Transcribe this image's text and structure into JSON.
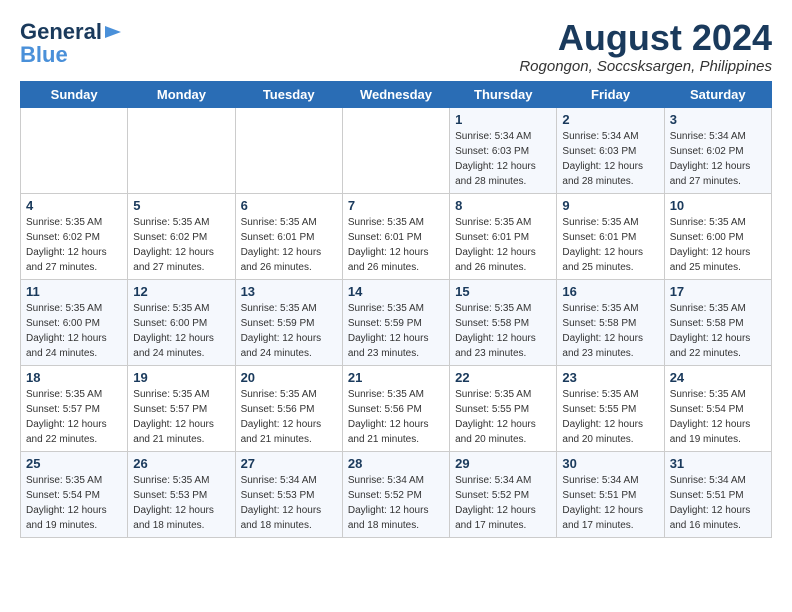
{
  "logo": {
    "line1": "General",
    "line2": "Blue"
  },
  "title": "August 2024",
  "location": "Rogongon, Soccsksargen, Philippines",
  "days_of_week": [
    "Sunday",
    "Monday",
    "Tuesday",
    "Wednesday",
    "Thursday",
    "Friday",
    "Saturday"
  ],
  "weeks": [
    [
      {
        "num": "",
        "info": ""
      },
      {
        "num": "",
        "info": ""
      },
      {
        "num": "",
        "info": ""
      },
      {
        "num": "",
        "info": ""
      },
      {
        "num": "1",
        "info": "Sunrise: 5:34 AM\nSunset: 6:03 PM\nDaylight: 12 hours\nand 28 minutes."
      },
      {
        "num": "2",
        "info": "Sunrise: 5:34 AM\nSunset: 6:03 PM\nDaylight: 12 hours\nand 28 minutes."
      },
      {
        "num": "3",
        "info": "Sunrise: 5:34 AM\nSunset: 6:02 PM\nDaylight: 12 hours\nand 27 minutes."
      }
    ],
    [
      {
        "num": "4",
        "info": "Sunrise: 5:35 AM\nSunset: 6:02 PM\nDaylight: 12 hours\nand 27 minutes."
      },
      {
        "num": "5",
        "info": "Sunrise: 5:35 AM\nSunset: 6:02 PM\nDaylight: 12 hours\nand 27 minutes."
      },
      {
        "num": "6",
        "info": "Sunrise: 5:35 AM\nSunset: 6:01 PM\nDaylight: 12 hours\nand 26 minutes."
      },
      {
        "num": "7",
        "info": "Sunrise: 5:35 AM\nSunset: 6:01 PM\nDaylight: 12 hours\nand 26 minutes."
      },
      {
        "num": "8",
        "info": "Sunrise: 5:35 AM\nSunset: 6:01 PM\nDaylight: 12 hours\nand 26 minutes."
      },
      {
        "num": "9",
        "info": "Sunrise: 5:35 AM\nSunset: 6:01 PM\nDaylight: 12 hours\nand 25 minutes."
      },
      {
        "num": "10",
        "info": "Sunrise: 5:35 AM\nSunset: 6:00 PM\nDaylight: 12 hours\nand 25 minutes."
      }
    ],
    [
      {
        "num": "11",
        "info": "Sunrise: 5:35 AM\nSunset: 6:00 PM\nDaylight: 12 hours\nand 24 minutes."
      },
      {
        "num": "12",
        "info": "Sunrise: 5:35 AM\nSunset: 6:00 PM\nDaylight: 12 hours\nand 24 minutes."
      },
      {
        "num": "13",
        "info": "Sunrise: 5:35 AM\nSunset: 5:59 PM\nDaylight: 12 hours\nand 24 minutes."
      },
      {
        "num": "14",
        "info": "Sunrise: 5:35 AM\nSunset: 5:59 PM\nDaylight: 12 hours\nand 23 minutes."
      },
      {
        "num": "15",
        "info": "Sunrise: 5:35 AM\nSunset: 5:58 PM\nDaylight: 12 hours\nand 23 minutes."
      },
      {
        "num": "16",
        "info": "Sunrise: 5:35 AM\nSunset: 5:58 PM\nDaylight: 12 hours\nand 23 minutes."
      },
      {
        "num": "17",
        "info": "Sunrise: 5:35 AM\nSunset: 5:58 PM\nDaylight: 12 hours\nand 22 minutes."
      }
    ],
    [
      {
        "num": "18",
        "info": "Sunrise: 5:35 AM\nSunset: 5:57 PM\nDaylight: 12 hours\nand 22 minutes."
      },
      {
        "num": "19",
        "info": "Sunrise: 5:35 AM\nSunset: 5:57 PM\nDaylight: 12 hours\nand 21 minutes."
      },
      {
        "num": "20",
        "info": "Sunrise: 5:35 AM\nSunset: 5:56 PM\nDaylight: 12 hours\nand 21 minutes."
      },
      {
        "num": "21",
        "info": "Sunrise: 5:35 AM\nSunset: 5:56 PM\nDaylight: 12 hours\nand 21 minutes."
      },
      {
        "num": "22",
        "info": "Sunrise: 5:35 AM\nSunset: 5:55 PM\nDaylight: 12 hours\nand 20 minutes."
      },
      {
        "num": "23",
        "info": "Sunrise: 5:35 AM\nSunset: 5:55 PM\nDaylight: 12 hours\nand 20 minutes."
      },
      {
        "num": "24",
        "info": "Sunrise: 5:35 AM\nSunset: 5:54 PM\nDaylight: 12 hours\nand 19 minutes."
      }
    ],
    [
      {
        "num": "25",
        "info": "Sunrise: 5:35 AM\nSunset: 5:54 PM\nDaylight: 12 hours\nand 19 minutes."
      },
      {
        "num": "26",
        "info": "Sunrise: 5:35 AM\nSunset: 5:53 PM\nDaylight: 12 hours\nand 18 minutes."
      },
      {
        "num": "27",
        "info": "Sunrise: 5:34 AM\nSunset: 5:53 PM\nDaylight: 12 hours\nand 18 minutes."
      },
      {
        "num": "28",
        "info": "Sunrise: 5:34 AM\nSunset: 5:52 PM\nDaylight: 12 hours\nand 18 minutes."
      },
      {
        "num": "29",
        "info": "Sunrise: 5:34 AM\nSunset: 5:52 PM\nDaylight: 12 hours\nand 17 minutes."
      },
      {
        "num": "30",
        "info": "Sunrise: 5:34 AM\nSunset: 5:51 PM\nDaylight: 12 hours\nand 17 minutes."
      },
      {
        "num": "31",
        "info": "Sunrise: 5:34 AM\nSunset: 5:51 PM\nDaylight: 12 hours\nand 16 minutes."
      }
    ]
  ]
}
